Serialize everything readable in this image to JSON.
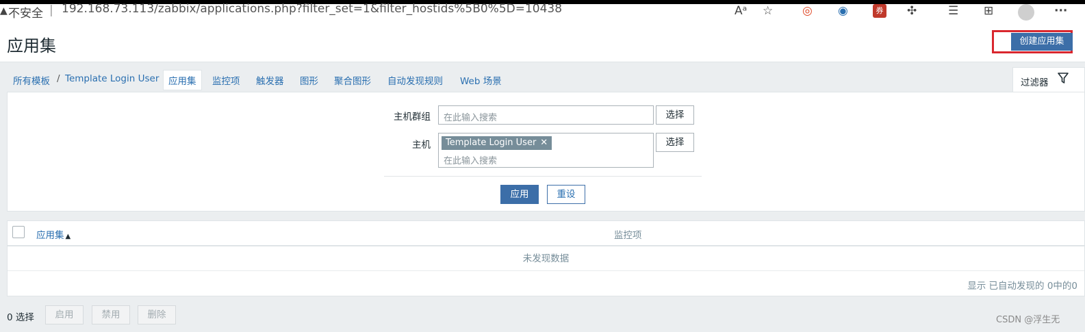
{
  "browser": {
    "security_label": "不安全",
    "url": "192.168.73.113/zabbix/applications.php?filter_set=1&filter_hostids%5B0%5D=10438",
    "read_aloud_glyph": "Aᵃ",
    "menu_glyph": "···",
    "ext_badge": "券"
  },
  "header": {
    "title": "应用集",
    "create_button": "创建应用集"
  },
  "nav": {
    "breadcrumb_all": "所有模板",
    "separator": "/",
    "breadcrumb_host": "Template Login User",
    "tabs": [
      "应用集",
      "监控项",
      "触发器",
      "图形",
      "聚合图形",
      "自动发现规则",
      "Web 场景"
    ],
    "filter_tab": "过滤器"
  },
  "filter": {
    "host_group_label": "主机群组",
    "host_group_placeholder": "在此输入搜索",
    "host_label": "主机",
    "host_chip": "Template Login User",
    "host_placeholder": "在此输入搜索",
    "select_button": "选择",
    "apply_button": "应用",
    "reset_button": "重设"
  },
  "table": {
    "col_application": "应用集",
    "sort_arrow": "▲",
    "col_items": "监控项",
    "no_data": "未发现数据",
    "paging": "显示 已自动发现的 0中的0"
  },
  "footer": {
    "selected_count": "0 选择",
    "enable_button": "启用",
    "disable_button": "禁用",
    "delete_button": "删除"
  },
  "watermark": "CSDN @浮生无",
  "colors": {
    "primary": "#3c6ea8",
    "link": "#2a6fb0",
    "highlight_border": "#d9272e",
    "chip": "#768d99",
    "background": "#ebeef0"
  }
}
